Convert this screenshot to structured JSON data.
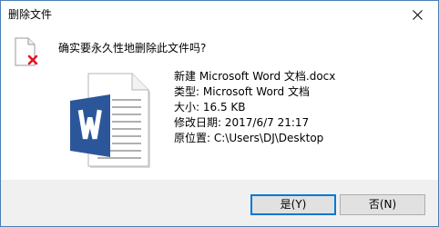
{
  "window": {
    "title": "删除文件",
    "close_icon": "close-icon"
  },
  "prompt": {
    "question": "确实要永久性地删除此文件吗?",
    "icon": "delete-file-icon"
  },
  "file": {
    "icon": "word-document-icon",
    "name_line": "新建 Microsoft Word 文档.docx",
    "type_line": "类型: Microsoft Word 文档",
    "size_line": "大小: 16.5 KB",
    "modified_line": "修改日期: 2017/6/7 21:17",
    "location_line": "原位置: C:\\Users\\DJ\\Desktop"
  },
  "buttons": {
    "yes_label": "是(Y)",
    "no_label": "否(N)"
  },
  "colors": {
    "border": "#4a7fb5",
    "footer_bg": "#f0f0f0",
    "default_button_border": "#0078d7",
    "word_blue": "#2b579a",
    "delete_red": "#e81123"
  }
}
